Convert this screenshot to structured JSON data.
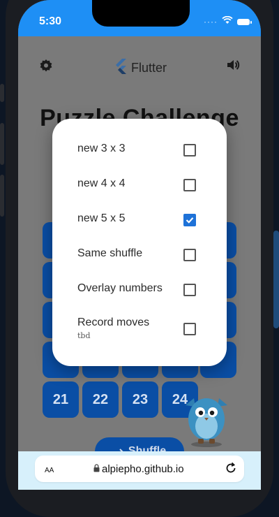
{
  "status": {
    "time": "5:30"
  },
  "app": {
    "brand": "Flutter",
    "title": "Puzzle Challenge",
    "shuffle_label": "Shuffle",
    "tiles": [
      {
        "label": "21"
      },
      {
        "label": "22"
      },
      {
        "label": "23"
      },
      {
        "label": "24"
      }
    ]
  },
  "dialog": {
    "options": [
      {
        "label": "new 3 x 3",
        "checked": false
      },
      {
        "label": "new 4 x 4",
        "checked": false
      },
      {
        "label": "new 5 x 5",
        "checked": true
      },
      {
        "label": "Same shuffle",
        "checked": false
      },
      {
        "label": "Overlay numbers",
        "checked": false
      },
      {
        "label": "Record moves",
        "sublabel": "tbd",
        "checked": false
      }
    ]
  },
  "browser": {
    "text_size_label": "AA",
    "url": "alpiepho.github.io"
  },
  "colors": {
    "status_bar": "#1e8ff5",
    "tile": "#0a4ea5",
    "checkbox_checked": "#1e72d8"
  }
}
